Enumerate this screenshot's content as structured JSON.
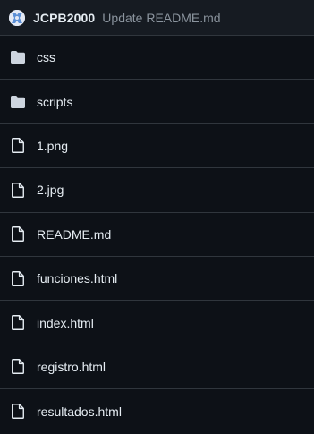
{
  "commit": {
    "author": "JCPB2000",
    "message": "Update README.md",
    "avatar_icon": "identicon-avatar"
  },
  "files": [
    {
      "name": "css",
      "type": "folder",
      "icon": "folder-icon"
    },
    {
      "name": "scripts",
      "type": "folder",
      "icon": "folder-icon"
    },
    {
      "name": "1.png",
      "type": "file",
      "icon": "file-icon"
    },
    {
      "name": "2.jpg",
      "type": "file",
      "icon": "file-icon"
    },
    {
      "name": "README.md",
      "type": "file",
      "icon": "file-icon"
    },
    {
      "name": "funciones.html",
      "type": "file",
      "icon": "file-icon"
    },
    {
      "name": "index.html",
      "type": "file",
      "icon": "file-icon"
    },
    {
      "name": "registro.html",
      "type": "file",
      "icon": "file-icon"
    },
    {
      "name": "resultados.html",
      "type": "file",
      "icon": "file-icon"
    }
  ],
  "colors": {
    "background": "#0d1117",
    "header_background": "#161b22",
    "border": "#30363d",
    "text": "#e6edf3",
    "muted_text": "#8b949e",
    "folder_icon": "#cdd5df",
    "file_icon": "#e6edf3"
  }
}
